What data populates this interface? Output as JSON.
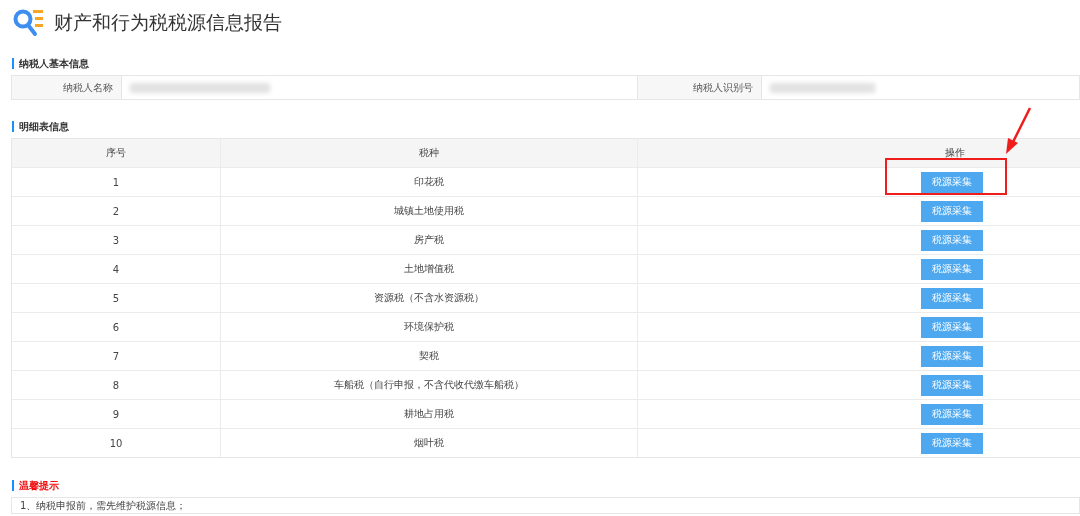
{
  "page_title": "财产和行为税税源信息报告",
  "taxpayer_section": {
    "heading": "纳税人基本信息",
    "fields": [
      {
        "label": "纳税人名称",
        "redacted": true
      },
      {
        "label": "纳税人识别号",
        "redacted": true
      }
    ]
  },
  "detail_section": {
    "heading": "明细表信息",
    "columns": [
      "序号",
      "税种",
      "操作"
    ],
    "rows": [
      {
        "index": "1",
        "tax": "印花税",
        "action": "税源采集",
        "highlighted": true
      },
      {
        "index": "2",
        "tax": "城镇土地使用税",
        "action": "税源采集",
        "highlighted": false
      },
      {
        "index": "3",
        "tax": "房产税",
        "action": "税源采集",
        "highlighted": false
      },
      {
        "index": "4",
        "tax": "土地增值税",
        "action": "税源采集",
        "highlighted": false
      },
      {
        "index": "5",
        "tax": "资源税（不含水资源税）",
        "action": "税源采集",
        "highlighted": false
      },
      {
        "index": "6",
        "tax": "环境保护税",
        "action": "税源采集",
        "highlighted": false
      },
      {
        "index": "7",
        "tax": "契税",
        "action": "税源采集",
        "highlighted": false
      },
      {
        "index": "8",
        "tax": "车船税（自行申报，不含代收代缴车船税）",
        "action": "税源采集",
        "highlighted": false
      },
      {
        "index": "9",
        "tax": "耕地占用税",
        "action": "税源采集",
        "highlighted": false
      },
      {
        "index": "10",
        "tax": "烟叶税",
        "action": "税源采集",
        "highlighted": false
      }
    ]
  },
  "tips_section": {
    "heading": "温馨提示",
    "items": [
      "1、纳税申报前，需先维护税源信息；"
    ]
  }
}
